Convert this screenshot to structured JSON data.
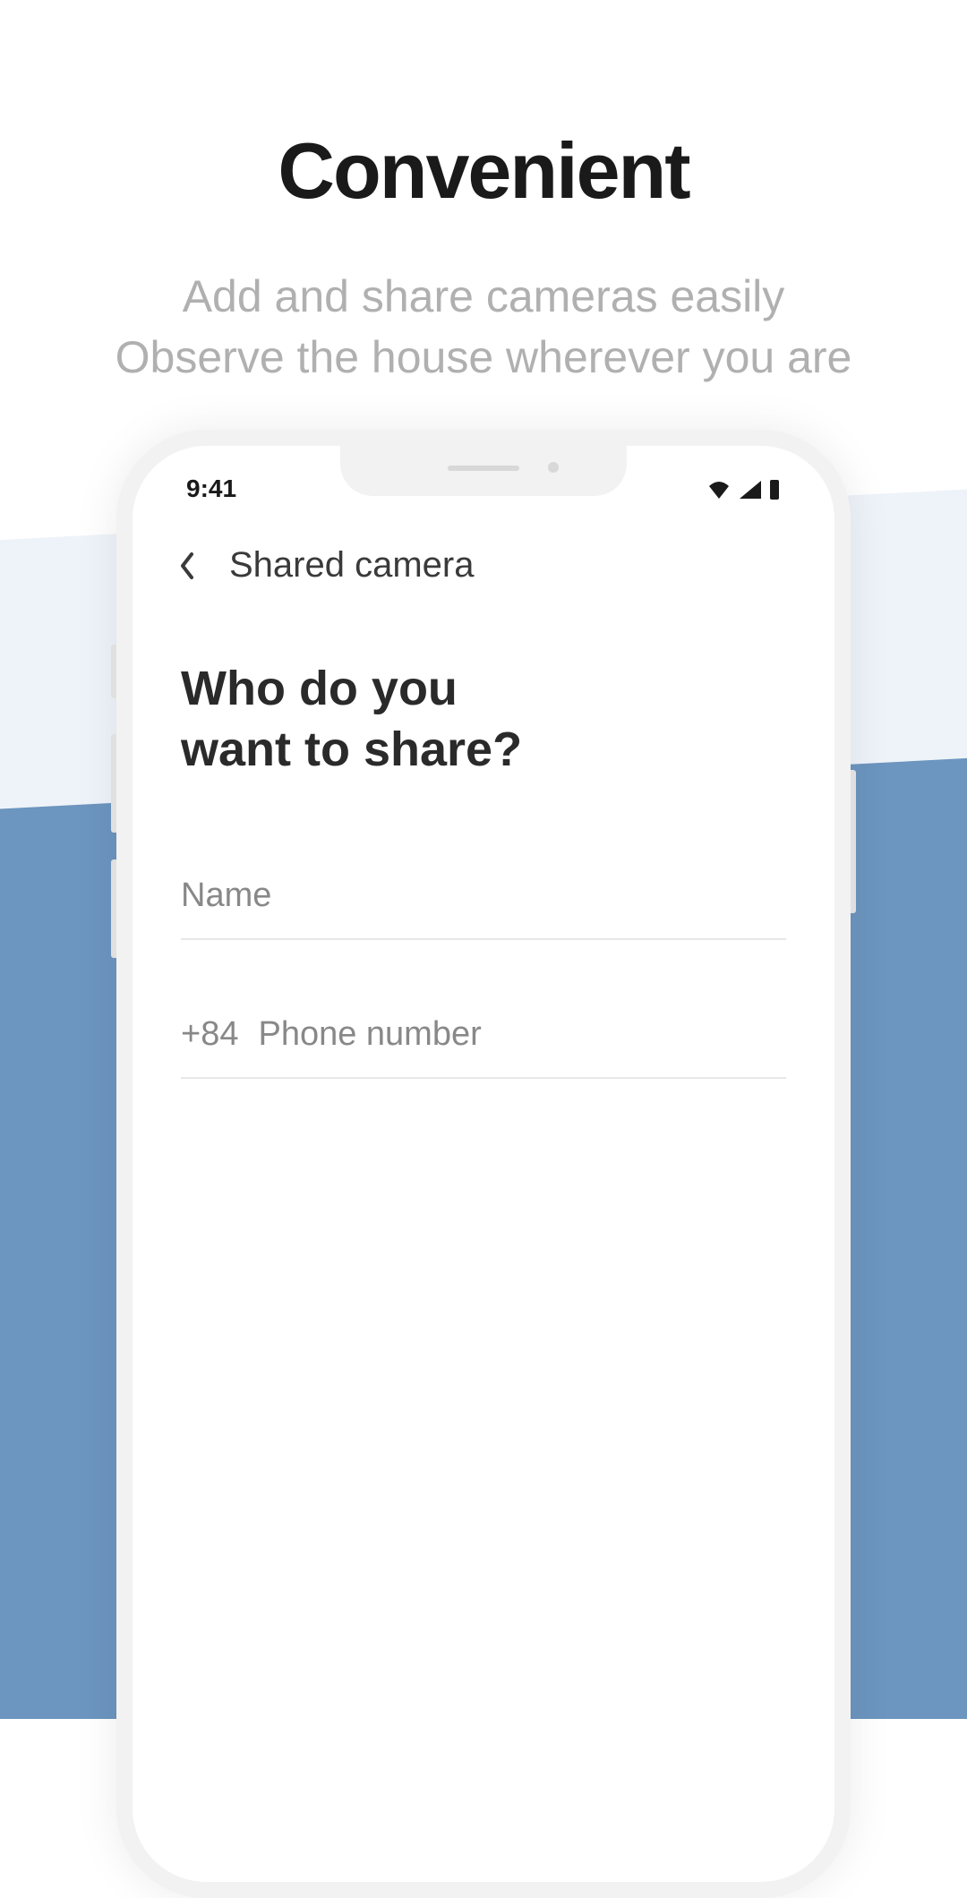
{
  "marketing": {
    "title": "Convenient",
    "subtitle_line1": "Add and share cameras easily",
    "subtitle_line2": "Observe the house wherever you are"
  },
  "status_bar": {
    "time": "9:41"
  },
  "app": {
    "header_title": "Shared camera",
    "question_line1": "Who do you",
    "question_line2": "want to share?",
    "name_placeholder": "Name",
    "country_code": "+84",
    "phone_placeholder": "Phone number"
  }
}
